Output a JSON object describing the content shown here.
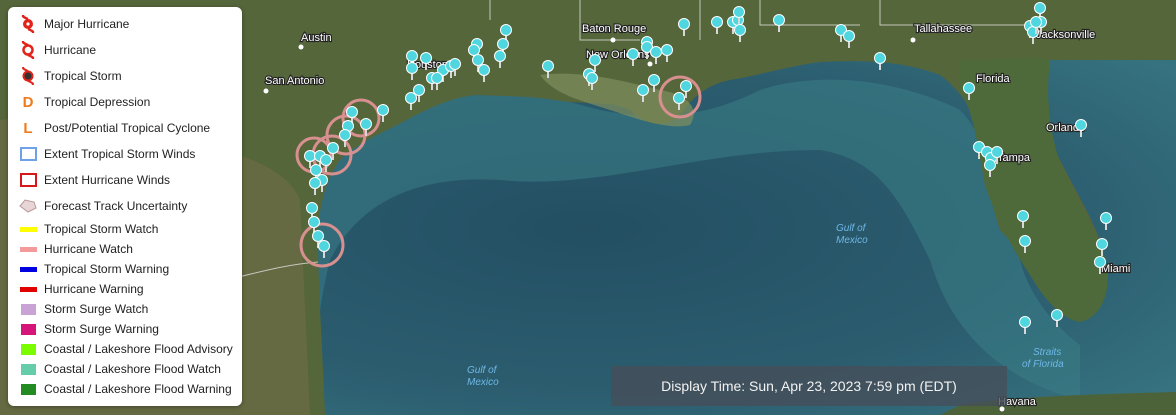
{
  "legend": {
    "items": [
      {
        "label": "Major Hurricane",
        "icon": "major-hurricane-icon",
        "color": "#e2231a"
      },
      {
        "label": "Hurricane",
        "icon": "hurricane-icon",
        "color": "#e2231a"
      },
      {
        "label": "Tropical Storm",
        "icon": "tropical-storm-icon",
        "color": "#e2231a"
      },
      {
        "label": "Tropical Depression",
        "icon": "tropical-depression-icon",
        "color": "#f07a1a"
      },
      {
        "label": "Post/Potential Tropical Cyclone",
        "icon": "post-tropical-cyclone-icon",
        "color": "#f07a1a"
      },
      {
        "label": "Extent Tropical Storm Winds",
        "icon": "ts-winds-extent-icon",
        "color": "#6fa0e8"
      },
      {
        "label": "Extent Hurricane Winds",
        "icon": "hurricane-winds-extent-icon",
        "color": "#d81818"
      },
      {
        "label": "Forecast Track Uncertainty",
        "icon": "track-uncertainty-icon",
        "color": "#e8d6d6"
      },
      {
        "label": "Tropical Storm Watch",
        "icon": "ts-watch-swatch",
        "color": "#ffff00"
      },
      {
        "label": "Hurricane Watch",
        "icon": "hurricane-watch-swatch",
        "color": "#f49a9a"
      },
      {
        "label": "Tropical Storm Warning",
        "icon": "ts-warning-swatch",
        "color": "#0000e0"
      },
      {
        "label": "Hurricane Warning",
        "icon": "hurricane-warning-swatch",
        "color": "#e00000"
      },
      {
        "label": "Storm Surge Watch",
        "icon": "surge-watch-swatch",
        "color": "#c9a2d6"
      },
      {
        "label": "Storm Surge Warning",
        "icon": "surge-warning-swatch",
        "color": "#d6157a"
      },
      {
        "label": "Coastal / Lakeshore Flood Advisory",
        "icon": "flood-advisory-swatch",
        "color": "#7cfc00"
      },
      {
        "label": "Coastal / Lakeshore Flood Watch",
        "icon": "flood-watch-swatch",
        "color": "#66cdaa"
      },
      {
        "label": "Coastal / Lakeshore Flood Warning",
        "icon": "flood-warning-swatch",
        "color": "#228b22"
      }
    ]
  },
  "display_time": "Display Time: Sun, Apr 23, 2023 7:59 pm (EDT)",
  "map": {
    "cities": [
      "Austin",
      "San Antonio",
      "Baton Rouge",
      "New Orleans",
      "Tallahassee",
      "Jacksonville",
      "Florida",
      "Orlando",
      "Tampa",
      "Miami",
      "Havana",
      "Houston"
    ],
    "water_labels": [
      "Gulf of",
      "Mexico",
      "Gulf of",
      "Mexico",
      "Straits",
      "of Florida"
    ],
    "marker_color": "#4fd6de",
    "ring_color": "#d7908f"
  }
}
